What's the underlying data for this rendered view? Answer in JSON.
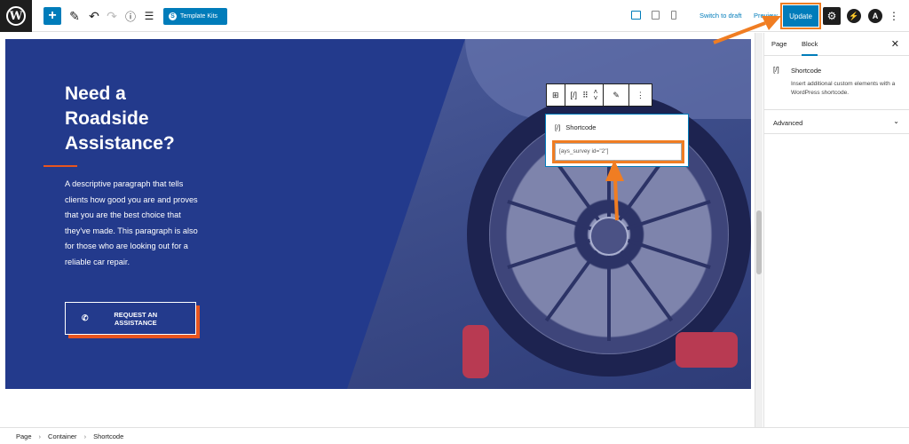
{
  "topbar": {
    "logo_text": "W",
    "template_kits_label": "Template Kits",
    "switch_to_draft_label": "Switch to draft",
    "preview_label": "Preview",
    "update_label": "Update"
  },
  "hero": {
    "headline": [
      "Need a",
      "Roadside",
      "Assistance?"
    ],
    "paragraph": "A descriptive paragraph that tells clients how good you are and proves that you are the best choice that they've made. This paragraph is also for those who are looking out for a reliable car repair.",
    "cta_line1": "REQUEST AN",
    "cta_line2": "ASSISTANCE"
  },
  "shortcode_block": {
    "icon": "[/]",
    "title": "Shortcode",
    "value": "[ays_survey id=\"2\"]"
  },
  "block_toolbar": {
    "shortcode_icon": "[/]"
  },
  "sidebar": {
    "tabs": [
      "Page",
      "Block"
    ],
    "active_tab": "Block",
    "block_icon": "[/]",
    "block_title": "Shortcode",
    "block_description": "Insert additional custom elements with a WordPress shortcode.",
    "section_advanced": "Advanced"
  },
  "breadcrumb": [
    "Page",
    "Container",
    "Shortcode"
  ],
  "colors": {
    "accent": "#007cba",
    "hero_bg": "#233a8c",
    "orange": "#e8551e",
    "annotation": "#f07d22"
  }
}
